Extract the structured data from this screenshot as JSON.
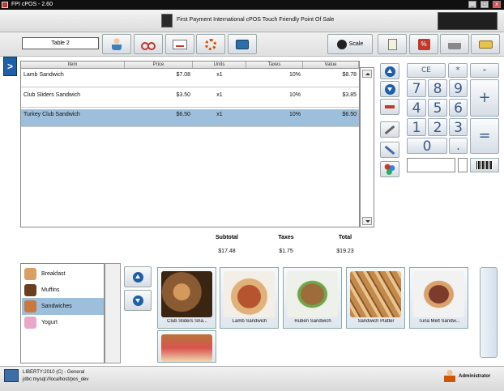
{
  "window": {
    "title": "FPI cPOS - 2.60",
    "buttons": [
      "_",
      "□",
      "x"
    ]
  },
  "header": {
    "tagline": "First Payment International cPOS    Touch Friendly Point Of Sale"
  },
  "toolbar": {
    "table_name": "Table 2",
    "scale_label": "Scale",
    "icons": [
      "customer-icon",
      "scissors-icon",
      "card-icon",
      "gear-icon",
      "camera-icon",
      "scale-icon",
      "receipt-icon",
      "discount-icon",
      "printer-icon",
      "cash-icon"
    ]
  },
  "sidebar_toggle": ">",
  "ticket": {
    "columns": [
      "Item",
      "Price",
      "Units",
      "Taxes",
      "Value"
    ],
    "rows": [
      {
        "item": "Lamb  Sandwich",
        "price": "$7.08",
        "units": "x1",
        "taxes": "10%",
        "value": "$8.78",
        "selected": false
      },
      {
        "item": "Club Sliders  Sandwich",
        "price": "$3.50",
        "units": "x1",
        "taxes": "10%",
        "value": "$3.85",
        "selected": false
      },
      {
        "item": "Turkey Club  Sandwich",
        "price": "$6.50",
        "units": "x1",
        "taxes": "10%",
        "value": "$6.50",
        "selected": true
      }
    ]
  },
  "keypad": {
    "ce": "CE",
    "star": "*",
    "minus": "-",
    "plus": "+",
    "equals": "=",
    "dot": ".",
    "digits": [
      "7",
      "8",
      "9",
      "4",
      "5",
      "6",
      "1",
      "2",
      "3",
      "0"
    ]
  },
  "totals": {
    "subtotal_label": "Subtotal",
    "taxes_label": "Taxes",
    "total_label": "Total",
    "subtotal": "$17.48",
    "taxes": "$1.75",
    "total": "$19.23"
  },
  "categories": [
    {
      "name": "Breakfast",
      "color": "#d9a066",
      "selected": false
    },
    {
      "name": "Muffins",
      "color": "#6b3e1f",
      "selected": false
    },
    {
      "name": "Sandwiches",
      "color": "#c87941",
      "selected": true
    },
    {
      "name": "Yogurt",
      "color": "#e8a9c8",
      "selected": false
    }
  ],
  "products": [
    {
      "name": "Club Sliders  Sna...",
      "color": "#8a5a33"
    },
    {
      "name": "Lamb  Sandwich",
      "color": "#b5542e"
    },
    {
      "name": "Ruben  Sandwich",
      "color": "#9e6b3a"
    },
    {
      "name": "Sandwich Platter",
      "color": "#c48a4c"
    },
    {
      "name": "Tuna Melt   Sandw...",
      "color": "#7d3b2c"
    },
    {
      "name": "",
      "color": "#b8743a"
    }
  ],
  "status": {
    "line1": "LIBERTY:2010 (C) - General",
    "line2": "jdbc:mysql://localhost/pos_dev",
    "user": "Administrator"
  }
}
